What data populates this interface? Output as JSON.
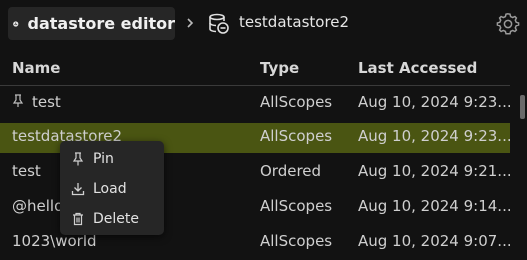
{
  "header": {
    "app_title": "datastore editor",
    "current_datastore": "testdatastore2",
    "logo_icon": "datastore-editor-logo-icon",
    "settings_icon": "gear-icon"
  },
  "table": {
    "columns": [
      "Name",
      "Type",
      "Last Accessed"
    ],
    "rows": [
      {
        "name": "test",
        "type": "AllScopes",
        "last_accessed": "Aug 10, 2024 9:23...",
        "pinned": true
      },
      {
        "name": "testdatastore2",
        "type": "AllScopes",
        "last_accessed": "Aug 10, 2024 9:23...",
        "selected": true
      },
      {
        "name": "test",
        "type": "Ordered",
        "last_accessed": "Aug 10, 2024 9:21..."
      },
      {
        "name": "@hello",
        "type": "AllScopes",
        "last_accessed": "Aug 10, 2024 9:14..."
      },
      {
        "name": "1023\\world",
        "type": "AllScopes",
        "last_accessed": "Aug 10, 2024 9:07..."
      }
    ]
  },
  "context_menu": {
    "items": [
      {
        "label": "Pin",
        "icon": "pin-icon"
      },
      {
        "label": "Load",
        "icon": "download-icon"
      },
      {
        "label": "Delete",
        "icon": "trash-icon"
      }
    ]
  },
  "colors": {
    "background": "#121212",
    "selected_row": "#4a5512",
    "menu_bg": "#262626"
  }
}
